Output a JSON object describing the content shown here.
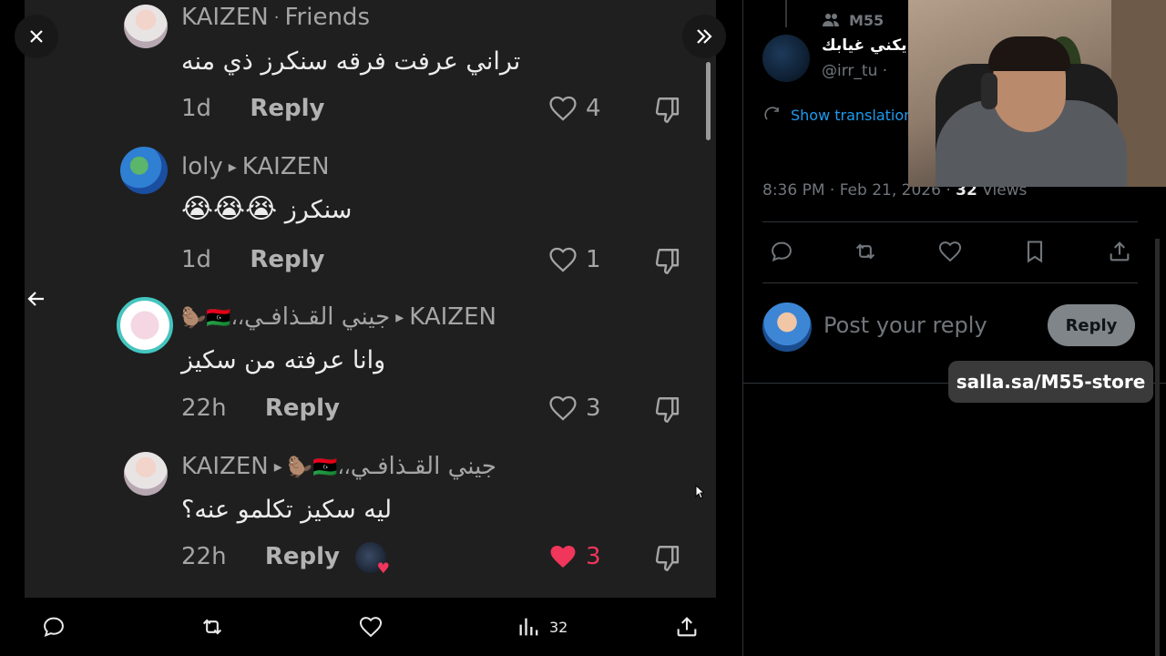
{
  "viewer": {
    "comments": [
      {
        "author": "KAIZEN",
        "relation": "Friends",
        "text": "تراني عرفت فرقه سنكرز ذي منه",
        "time": "1d",
        "reply_label": "Reply",
        "likes": "4",
        "liked": false
      },
      {
        "author": "loly",
        "reply_to": "KAIZEN",
        "text": "سنكرز",
        "emoji": "😭😭😭",
        "time": "1d",
        "reply_label": "Reply",
        "likes": "1",
        "liked": false
      },
      {
        "author": "جيني القـذافـي",
        "author_decor": "🦫🇱🇾،،",
        "reply_to": "KAIZEN",
        "text": "وانا عرفته من سكيز",
        "time": "22h",
        "reply_label": "Reply",
        "likes": "3",
        "liked": false
      },
      {
        "author": "KAIZEN",
        "reply_to": "جيني القـذافـي",
        "reply_to_decor": "🦫🇱🇾،،",
        "text": "ليه سكيز تكلمو عنه؟",
        "time": "22h",
        "reply_label": "Reply",
        "likes": "3",
        "liked": true
      }
    ],
    "bottom_bar": {
      "views": "32"
    }
  },
  "post": {
    "community": "M55",
    "author_name": "يكني غيابك",
    "handle": "@irr_tu ·",
    "show_translation": "Show translation",
    "timestamp": "8:36 PM · Feb 21, 2026 ·",
    "views_count": "32",
    "views_label": "Views",
    "reply_placeholder": "Post your reply",
    "reply_button": "Reply"
  },
  "overlay": {
    "store_link": "salla.sa/M55-store"
  },
  "colors": {
    "like_active": "#f0365b",
    "accent": "#1d9bf0",
    "panel": "#1f1f1f"
  },
  "icons": [
    "close-icon",
    "expand-icon",
    "back-arrow-icon",
    "heart-icon",
    "dislike-icon",
    "comment-icon",
    "repost-icon",
    "bookmark-icon",
    "share-icon",
    "views-icon",
    "translate-icon",
    "community-icon"
  ]
}
